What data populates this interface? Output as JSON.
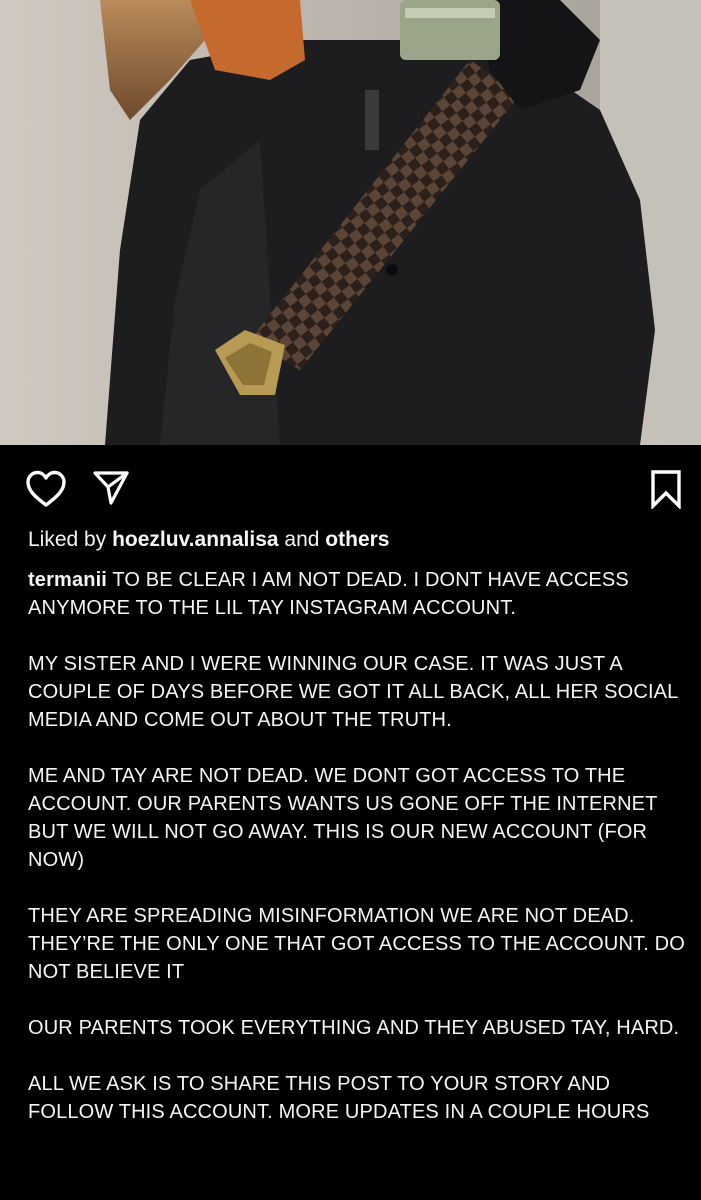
{
  "post": {
    "image_alt": "",
    "actions": {
      "like_icon": "heart-outline-icon",
      "share_icon": "paper-plane-icon",
      "save_icon": "bookmark-icon"
    },
    "liked_by": {
      "prefix": "Liked by",
      "user": "hoezluv.annalisa",
      "connector": "and",
      "others": "others"
    },
    "caption": {
      "username": "termanii",
      "paragraphs": [
        "TO BE CLEAR I AM NOT DEAD. I DONT HAVE ACCESS ANYMORE TO THE LIL TAY INSTAGRAM ACCOUNT.",
        "MY SISTER AND I WERE WINNING OUR CASE. IT WAS JUST A COUPLE OF DAYS BEFORE WE GOT IT ALL BACK, ALL HER SOCIAL MEDIA AND COME OUT ABOUT THE TRUTH.",
        "ME AND TAY ARE NOT DEAD. WE DONT GOT ACCESS TO THE ACCOUNT. OUR PARENTS WANTS US GONE OFF THE INTERNET BUT WE WILL NOT GO AWAY. THIS IS OUR NEW ACCOUNT (FOR NOW)",
        "THEY ARE SPREADING MISINFORMATION WE ARE NOT DEAD. THEY’RE THE ONLY ONE THAT GOT ACCESS TO THE ACCOUNT. DO NOT BELIEVE IT",
        "OUR PARENTS TOOK EVERYTHING AND THEY ABUSED TAY, HARD.",
        "ALL WE ASK IS TO SHARE THIS POST TO YOUR STORY AND FOLLOW THIS ACCOUNT. MORE UPDATES IN A COUPLE HOURS"
      ]
    }
  },
  "colors": {
    "background": "#000000",
    "text": "#f5f5f5",
    "icon": "#ffffff",
    "jacket": "#1f1f22",
    "wall": "#c9c4bb",
    "belt_brown": "#4a3a2e",
    "buckle_gold": "#b79a54"
  }
}
